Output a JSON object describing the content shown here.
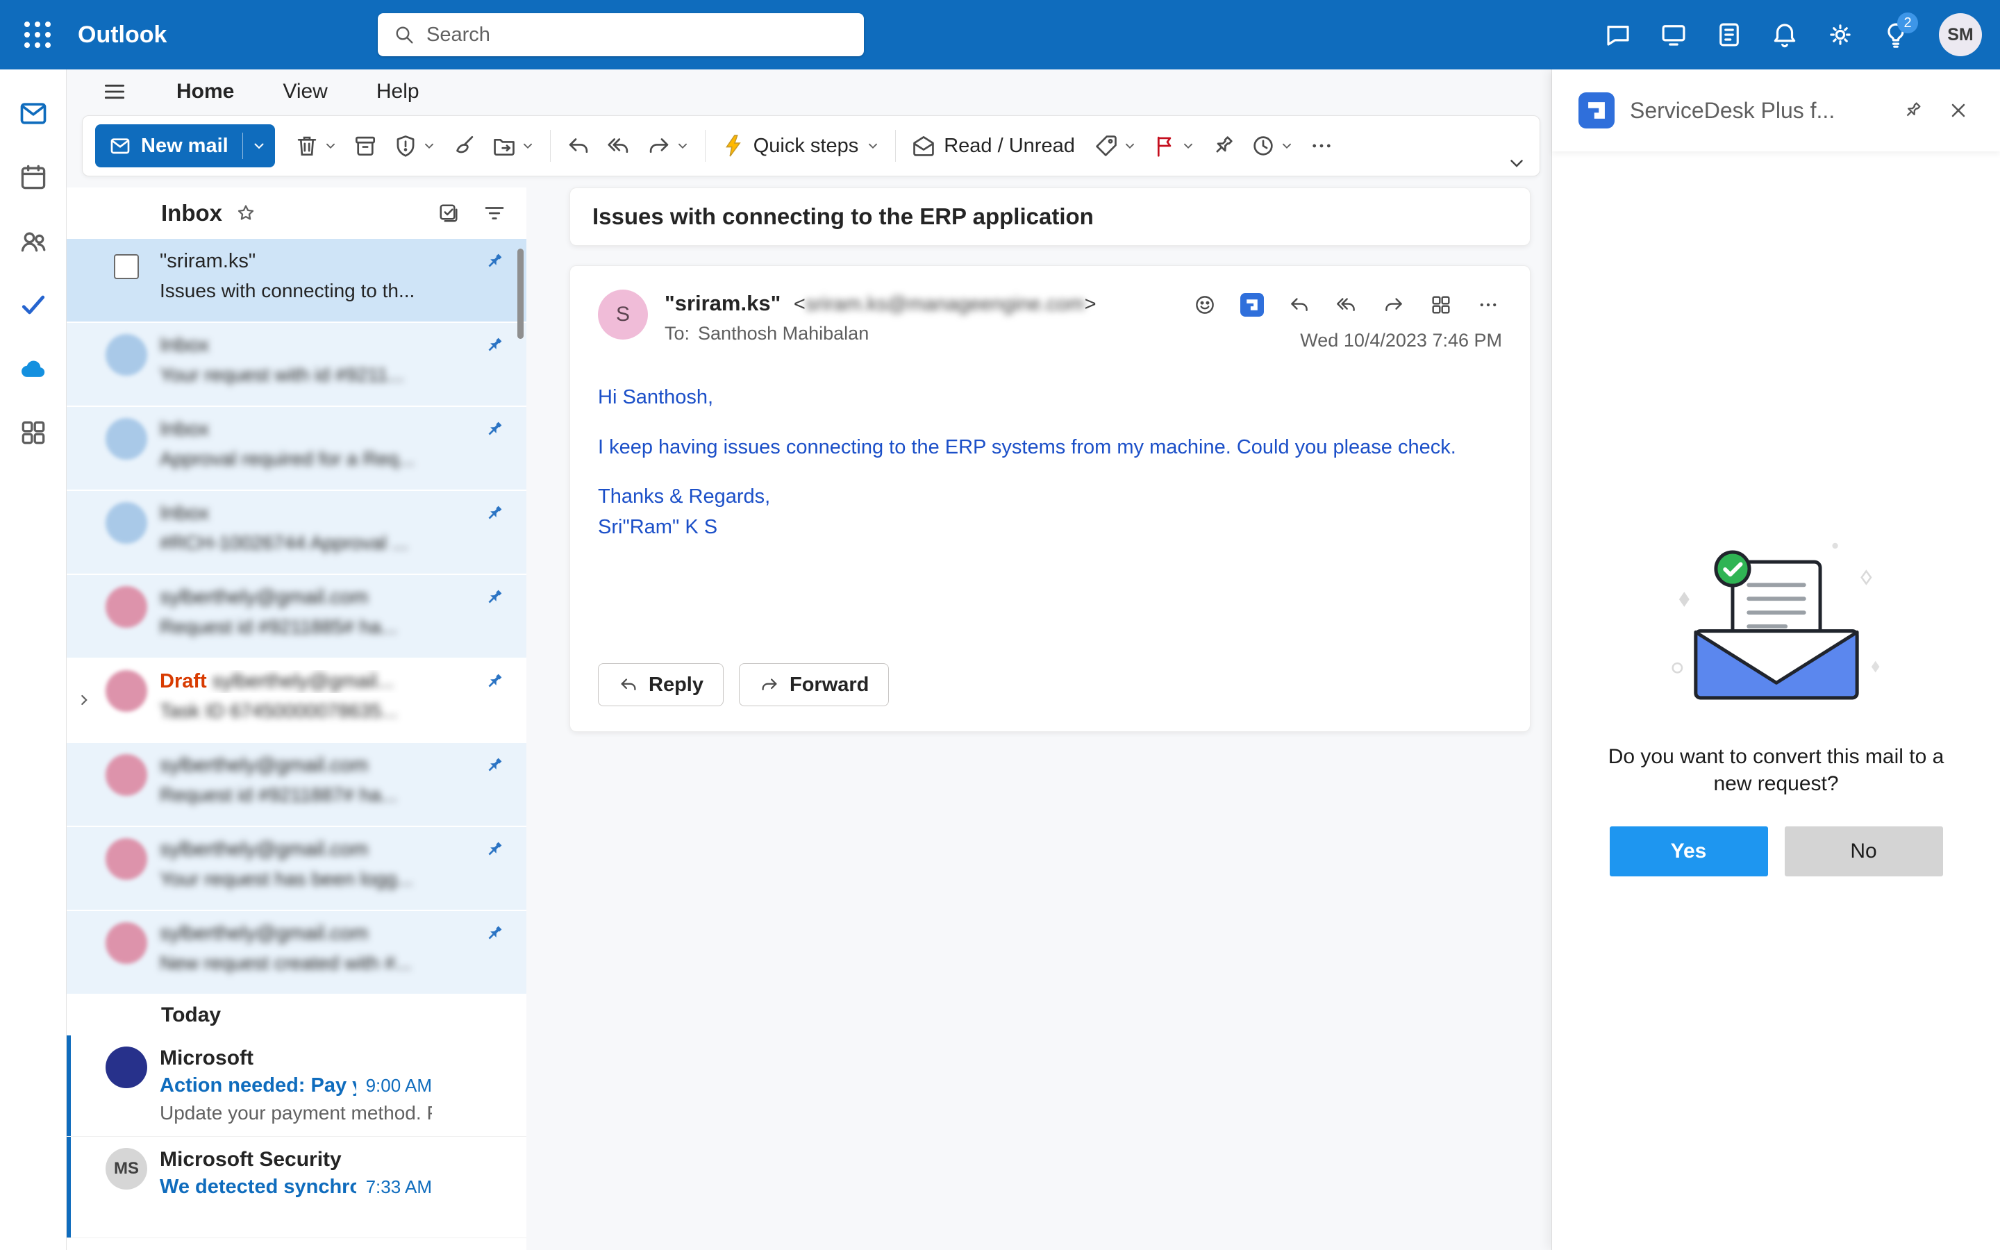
{
  "topbar": {
    "app_name": "Outlook",
    "search_placeholder": "Search",
    "tips_badge": "2",
    "avatar_initials": "SM"
  },
  "menubar": {
    "items": [
      "Home",
      "View",
      "Help"
    ]
  },
  "toolbar": {
    "new_mail_label": "New mail",
    "quick_steps_label": "Quick steps",
    "read_unread_label": "Read / Unread"
  },
  "mail_list": {
    "title": "Inbox",
    "today_label": "Today",
    "pinned": [
      {
        "sender": "\"sriram.ks\"",
        "subject": "Issues with connecting to th..."
      },
      {
        "sender": "Inbox",
        "subject": "Your request with id #9211..."
      },
      {
        "sender": "Inbox",
        "subject": "Approval required for a Req..."
      },
      {
        "sender": "Inbox",
        "subject": "#RCH-10026744 Approval ..."
      },
      {
        "sender": "sylberthely@gmail.com",
        "subject": "Request id #9211885# ha..."
      },
      {
        "draft_label": "Draft",
        "sender": "sylberthely@gmail...",
        "subject": "Task ID 67450000078635..."
      },
      {
        "sender": "sylberthely@gmail.com",
        "subject": "Request id #9211887# ha..."
      },
      {
        "sender": "sylberthely@gmail.com",
        "subject": "Your request has been logg..."
      },
      {
        "sender": "sylberthely@gmail.com",
        "subject": "New request created with #..."
      }
    ],
    "today": [
      {
        "sender": "Microsoft",
        "subject": "Action needed: Pay yo...",
        "time": "9:00 AM",
        "preview": "Update your payment method. Pa...",
        "initials": ""
      },
      {
        "sender": "Microsoft Security",
        "subject": "We detected synchroni...",
        "time": "7:33 AM",
        "preview": "",
        "initials": "MS"
      }
    ]
  },
  "reading": {
    "subject": "Issues with connecting to the ERP application",
    "avatar_initial": "S",
    "sender_name": "\"sriram.ks\"",
    "angle_open": "<",
    "sender_email": "sriram.ks@manageengine.com",
    "angle_close": ">",
    "to_label": "To:",
    "to_value": "Santhosh Mahibalan",
    "date": "Wed 10/4/2023 7:46 PM",
    "body_lines": [
      "Hi Santhosh,",
      "I keep having issues connecting to the ERP systems from my machine. Could you please check.",
      "Thanks & Regards,",
      "Sri\"Ram\" K S"
    ],
    "reply_label": "Reply",
    "forward_label": "Forward"
  },
  "addin": {
    "title": "ServiceDesk Plus f...",
    "prompt": "Do you want to convert this mail to a new request?",
    "yes_label": "Yes",
    "no_label": "No"
  },
  "icons": {
    "app-launcher": "3x3-dot-grid",
    "search": "magnifier",
    "notifications": "bell",
    "settings": "gear",
    "tips": "lightbulb",
    "pin": "pushpin",
    "flag": "flag",
    "quick-steps": "lightning-bolt"
  },
  "colors": {
    "header_blue": "#0f6cbd",
    "selected_row": "#cfe4f7",
    "unread_tint": "#eaf3fb",
    "body_text_blue": "#1b4fc8",
    "yes_button_blue": "#1e96f0",
    "no_button_gray": "#d4d4d4",
    "draft_orange": "#d83b01"
  }
}
